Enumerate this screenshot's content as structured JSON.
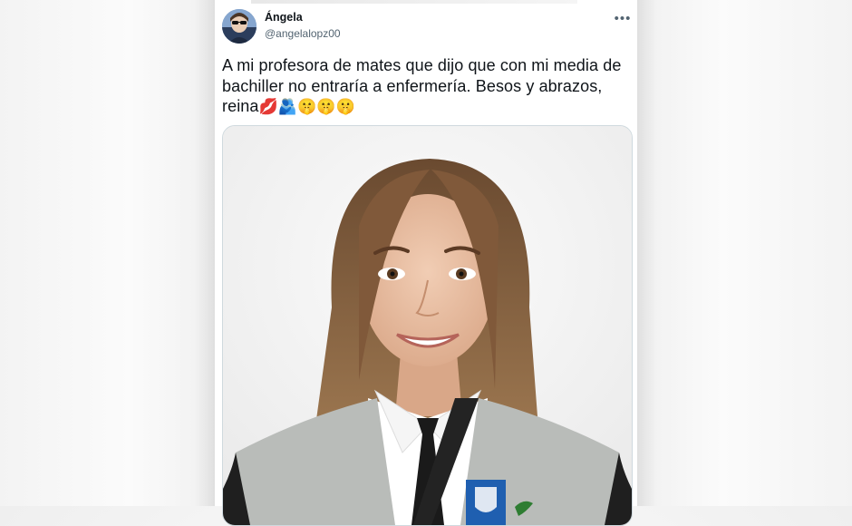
{
  "tweet": {
    "author_name": "Ángela",
    "author_handle": "@angelalopz00",
    "text": "A mi profesora de mates que dijo que con mi media de bachiller no entraría a enfermería. Besos y abrazos, reina",
    "emojis": "💋🫂🤫🤫🤫"
  },
  "icons": {
    "more": "more-horizontal-icon",
    "avatar": "profile-avatar",
    "media": "graduation-portrait-photo"
  },
  "colors": {
    "text_primary": "#0f1419",
    "text_secondary": "#536471",
    "border": "#cfd9de"
  }
}
